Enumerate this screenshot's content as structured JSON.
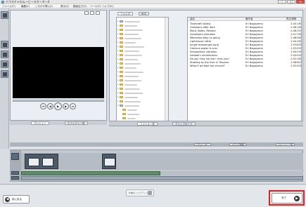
{
  "window": {
    "title": "テクスチャのムービースターター4",
    "minimize": "–",
    "maximize": "□",
    "close": "✕"
  },
  "menu": {
    "items": [
      "ファイル(F)",
      "編集(E)",
      "このかけ挿入(I)",
      "表示(V)",
      "動画出力(O)",
      "ツール(T)",
      "ヘルプ(H)"
    ]
  },
  "preview": {
    "tabs": [
      "プレビュー",
      "エフェクト一覧"
    ]
  },
  "browser": {
    "top_tabs": [
      "フォルダ",
      "RSS"
    ],
    "bottom_tabs": [
      "ファイル一覧",
      "クリップボード"
    ],
    "columns": {
      "name": "曲名",
      "artist": "著作者",
      "duration": "再生時間"
    },
    "files": [
      {
        "name": "Tinkerbell lullaby",
        "artist": "Eri Nagayama",
        "duration": "2:45:185"
      },
      {
        "name": "Questions after dark",
        "artist": "Eri Nagayama",
        "duration": "2:48:165"
      },
      {
        "name": "Read, Notes, Restore",
        "artist": "Eri Nagayama",
        "duration": "2:48:325"
      },
      {
        "name": "Xylophone pirouette",
        "artist": "Eri Nagayama",
        "duration": "2:51:765"
      },
      {
        "name": "Memories keep us going",
        "artist": "Eri Nagayama",
        "duration": "2:48:065"
      },
      {
        "name": "Lighthouse rattle",
        "artist": "Eri Nagayama",
        "duration": "2:44:185"
      },
      {
        "name": "Jungle messenger song",
        "artist": "Eri Nagayama",
        "duration": "2:53:835"
      },
      {
        "name": "Glorious power is ours",
        "artist": "Eri Nagayama",
        "duration": "2:53:055"
      },
      {
        "name": "Intergalactic vibration",
        "artist": "Eri Nagayama",
        "duration": "2:50:035"
      },
      {
        "name": "Sodade's recollections",
        "artist": "Eri Nagayama",
        "duration": "2:45:545"
      },
      {
        "name": "Do you miss me like I miss you?",
        "artist": "Eri Nagayama",
        "duration": "2:52:165"
      },
      {
        "name": "Strolling by the river in Toscane",
        "artist": "Eri Nagayama",
        "duration": "2:48:825"
      },
      {
        "name": "What if we take the chance?",
        "artist": "Eri Nagayama",
        "duration": "2:53:935"
      }
    ]
  },
  "timeline": {
    "toolbar": [
      "パラメーター",
      "ドラッグ移動",
      "ストーリー一覧"
    ]
  },
  "footer": {
    "back_label": "前に戻る",
    "mid_label": "作業をバックアップ",
    "done_label": "完了",
    "back_arrow": "◀",
    "done_arrow": "▶"
  }
}
